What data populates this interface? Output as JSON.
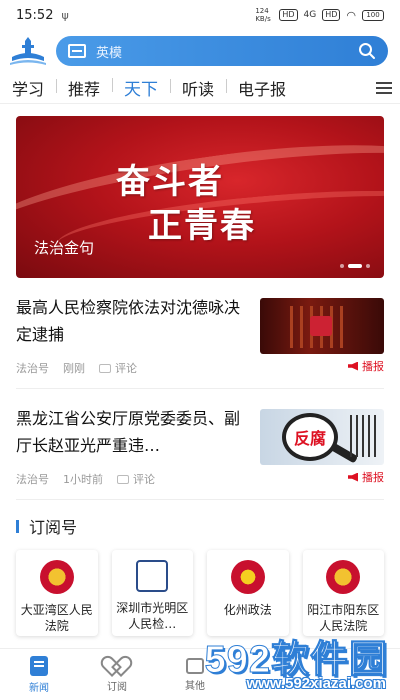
{
  "status_bar": {
    "time": "15:52",
    "usb_symbol": "ψ",
    "speed": "124 KB/s",
    "hd1": "HD",
    "signal_label": "4G",
    "hd2": "HD",
    "battery": "100"
  },
  "search": {
    "placeholder": "英模"
  },
  "tabs": [
    {
      "label": "学习"
    },
    {
      "label": "推荐"
    },
    {
      "label": "天下"
    },
    {
      "label": "听读"
    },
    {
      "label": "电子报"
    }
  ],
  "banner": {
    "art_line1": "奋斗者",
    "art_line2": "正青春",
    "caption": "法治金句"
  },
  "news": [
    {
      "title": "最高人民检察院依法对沈德咏决定逮捕",
      "source": "法治号",
      "time": "刚刚",
      "comment": "评论",
      "broadcast": "播报",
      "thumb_text": ""
    },
    {
      "title": "黑龙江省公安厅原党委委员、副厅长赵亚光严重违…",
      "source": "法治号",
      "time": "1小时前",
      "comment": "评论",
      "broadcast": "播报",
      "thumb_text": "反腐"
    }
  ],
  "subscriptions": {
    "header": "订阅号",
    "items": [
      {
        "name": "大亚湾区人民法院"
      },
      {
        "name": "深圳市光明区人民检…"
      },
      {
        "name": "化州政法"
      },
      {
        "name": "阳江市阳东区人民法院"
      }
    ]
  },
  "bottom_nav": [
    {
      "label": "新闻"
    },
    {
      "label": "订阅"
    },
    {
      "label": "其他"
    }
  ],
  "watermark": {
    "big": "592软件园",
    "small": "www.592xiazai.com"
  },
  "colors": {
    "accent": "#2f7fd6",
    "broadcast_red": "#dd1122"
  }
}
